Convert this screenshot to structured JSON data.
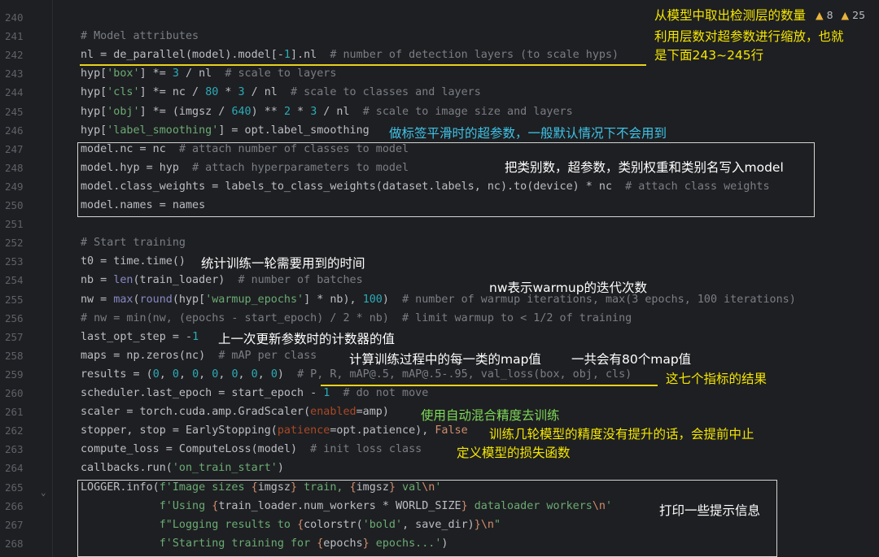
{
  "editor": {
    "inspections": {
      "weak_warnings": "8",
      "warnings": "25"
    },
    "lines": [
      {
        "num": "240",
        "tokens": []
      },
      {
        "num": "241",
        "tokens": [
          [
            "cm",
            "# Model attributes"
          ]
        ]
      },
      {
        "num": "242",
        "tokens": [
          [
            "",
            "nl = de_parallel(model).model[-"
          ],
          [
            "num",
            "1"
          ],
          [
            "",
            "].nl  "
          ],
          [
            "cm",
            "# number of detection layers (to scale hyps)"
          ]
        ]
      },
      {
        "num": "243",
        "tokens": [
          [
            "",
            "hyp["
          ],
          [
            "str",
            "'box'"
          ],
          [
            "",
            "] *= "
          ],
          [
            "num",
            "3"
          ],
          [
            "",
            " / nl  "
          ],
          [
            "cm",
            "# scale to layers"
          ]
        ]
      },
      {
        "num": "244",
        "tokens": [
          [
            "",
            "hyp["
          ],
          [
            "str",
            "'cls'"
          ],
          [
            "",
            "] *= nc / "
          ],
          [
            "num",
            "80"
          ],
          [
            "",
            " * "
          ],
          [
            "num",
            "3"
          ],
          [
            "",
            " / nl  "
          ],
          [
            "cm",
            "# scale to classes and layers"
          ]
        ]
      },
      {
        "num": "245",
        "tokens": [
          [
            "",
            "hyp["
          ],
          [
            "str",
            "'obj'"
          ],
          [
            "",
            "] *= (imgsz / "
          ],
          [
            "num",
            "640"
          ],
          [
            "",
            ") ** "
          ],
          [
            "num",
            "2"
          ],
          [
            "",
            " * "
          ],
          [
            "num",
            "3"
          ],
          [
            "",
            " / nl  "
          ],
          [
            "cm",
            "# scale to image size and layers"
          ]
        ]
      },
      {
        "num": "246",
        "tokens": [
          [
            "",
            "hyp["
          ],
          [
            "str",
            "'label_smoothing'"
          ],
          [
            "",
            "] = opt.label_smoothing"
          ]
        ]
      },
      {
        "num": "247",
        "tokens": [
          [
            "",
            "model.nc = nc  "
          ],
          [
            "cm",
            "# attach number of classes to model"
          ]
        ]
      },
      {
        "num": "248",
        "tokens": [
          [
            "",
            "model.hyp = hyp  "
          ],
          [
            "cm",
            "# attach hyperparameters to model"
          ]
        ]
      },
      {
        "num": "249",
        "tokens": [
          [
            "",
            "model.class_weights = labels_to_class_weights(dataset.labels, nc).to(device) * nc  "
          ],
          [
            "cm",
            "# attach class weights"
          ]
        ]
      },
      {
        "num": "250",
        "tokens": [
          [
            "",
            "model.names = names"
          ]
        ]
      },
      {
        "num": "251",
        "tokens": []
      },
      {
        "num": "252",
        "tokens": [
          [
            "cm",
            "# Start training"
          ]
        ]
      },
      {
        "num": "253",
        "tokens": [
          [
            "",
            "t0 = time.time()"
          ]
        ]
      },
      {
        "num": "254",
        "tokens": [
          [
            "",
            "nb = "
          ],
          [
            "bi",
            "len"
          ],
          [
            "",
            "(train_loader)  "
          ],
          [
            "cm",
            "# number of batches"
          ]
        ]
      },
      {
        "num": "255",
        "tokens": [
          [
            "",
            "nw = "
          ],
          [
            "bi",
            "max"
          ],
          [
            "",
            "("
          ],
          [
            "bi",
            "round"
          ],
          [
            "",
            "(hyp["
          ],
          [
            "str",
            "'warmup_epochs'"
          ],
          [
            "",
            "] * nb), "
          ],
          [
            "num",
            "100"
          ],
          [
            "",
            ")  "
          ],
          [
            "cm",
            "# number of warmup iterations, max(3 epochs, 100 iterations)"
          ]
        ]
      },
      {
        "num": "256",
        "tokens": [
          [
            "cm",
            "# nw = min(nw, (epochs - start_epoch) / 2 * nb)  # limit warmup to < 1/2 of training"
          ]
        ]
      },
      {
        "num": "257",
        "tokens": [
          [
            "",
            "last_opt_step = -"
          ],
          [
            "num",
            "1"
          ]
        ]
      },
      {
        "num": "258",
        "tokens": [
          [
            "",
            "maps = np.zeros(nc)  "
          ],
          [
            "cm",
            "# mAP per class"
          ]
        ]
      },
      {
        "num": "259",
        "tokens": [
          [
            "",
            "results = ("
          ],
          [
            "num",
            "0"
          ],
          [
            "",
            ", "
          ],
          [
            "num",
            "0"
          ],
          [
            "",
            ", "
          ],
          [
            "num",
            "0"
          ],
          [
            "",
            ", "
          ],
          [
            "num",
            "0"
          ],
          [
            "",
            ", "
          ],
          [
            "num",
            "0"
          ],
          [
            "",
            ", "
          ],
          [
            "num",
            "0"
          ],
          [
            "",
            ", "
          ],
          [
            "num",
            "0"
          ],
          [
            "",
            ")  "
          ],
          [
            "cm",
            "# P, R, mAP@.5, mAP@.5-.95, val_loss(box, obj, cls)"
          ]
        ]
      },
      {
        "num": "260",
        "tokens": [
          [
            "",
            "scheduler.last_epoch = start_epoch - "
          ],
          [
            "num",
            "1"
          ],
          [
            "",
            "  "
          ],
          [
            "cm",
            "# do not move"
          ]
        ]
      },
      {
        "num": "261",
        "tokens": [
          [
            "",
            "scaler = torch.cuda.amp.GradScaler("
          ],
          [
            "prm",
            "enabled"
          ],
          [
            "",
            "=amp)"
          ]
        ]
      },
      {
        "num": "262",
        "tokens": [
          [
            "",
            "stopper, stop = EarlyStopping("
          ],
          [
            "prm",
            "patience"
          ],
          [
            "",
            "=opt.patience), "
          ],
          [
            "kw",
            "False"
          ]
        ]
      },
      {
        "num": "263",
        "tokens": [
          [
            "",
            "compute_loss = ComputeLoss(model)  "
          ],
          [
            "cm",
            "# init loss class"
          ]
        ]
      },
      {
        "num": "264",
        "tokens": [
          [
            "",
            "callbacks.run("
          ],
          [
            "str",
            "'on_train_start'"
          ],
          [
            "",
            ")"
          ]
        ]
      },
      {
        "num": "265",
        "tokens": [
          [
            "",
            "LOGGER.info("
          ],
          [
            "str",
            "f'Image sizes "
          ],
          [
            "sc",
            "{"
          ],
          [
            "fv",
            "imgsz"
          ],
          [
            "sc",
            "}"
          ],
          [
            "str",
            " train, "
          ],
          [
            "sc",
            "{"
          ],
          [
            "fv",
            "imgsz"
          ],
          [
            "sc",
            "}"
          ],
          [
            "str",
            " val"
          ],
          [
            "esc",
            "\\n"
          ],
          [
            "str",
            "'"
          ]
        ]
      },
      {
        "num": "266",
        "tokens": [
          [
            "",
            "            "
          ],
          [
            "str",
            "f'Using "
          ],
          [
            "sc",
            "{"
          ],
          [
            "fv",
            "train_loader.num_workers * WORLD_SIZE"
          ],
          [
            "sc",
            "}"
          ],
          [
            "str",
            " dataloader workers"
          ],
          [
            "esc",
            "\\n"
          ],
          [
            "str",
            "'"
          ]
        ]
      },
      {
        "num": "267",
        "tokens": [
          [
            "",
            "            "
          ],
          [
            "str",
            "f\"Logging results to "
          ],
          [
            "sc",
            "{"
          ],
          [
            "fv",
            "colorstr("
          ],
          [
            "str",
            "'bold'"
          ],
          [
            "fv",
            ", save_dir)"
          ],
          [
            "sc",
            "}"
          ],
          [
            "esc",
            "\\n"
          ],
          [
            "str",
            "\""
          ]
        ]
      },
      {
        "num": "268",
        "tokens": [
          [
            "",
            "            "
          ],
          [
            "str",
            "f'Starting training for "
          ],
          [
            "sc",
            "{"
          ],
          [
            "fv",
            "epochs"
          ],
          [
            "sc",
            "}"
          ],
          [
            "str",
            " epochs...'"
          ],
          [
            "",
            ")"
          ]
        ]
      }
    ]
  },
  "annotations": {
    "detect_layers": "从模型中取出检测层的数量",
    "scale_hyps": "利用层数对超参数进行缩放，也就",
    "lines_ref": "是下面243~245行",
    "label_smoothing": "做标签平滑时的超参数，一般默认情况下不会用到",
    "write_model": "把类别数，超参数，类别权重和类别名写入model",
    "epoch_time": "统计训练一轮需要用到的时间",
    "nw_desc": "nw表示warmup的迭代次数",
    "last_step": "上一次更新参数时的计数器的值",
    "map_per_class": "计算训练过程中的每一类的map值",
    "map_count": "一共会有80个map值",
    "seven_metrics": "这七个指标的结果",
    "amp": "使用自动混合精度去训练",
    "early_stop": "训练几轮模型的精度没有提升的话，会提前中止",
    "loss_fn": "定义模型的损失函数",
    "print_info": "打印一些提示信息"
  },
  "colors": {
    "background": "#1e1f22",
    "annotation_yellow": "#f4e600",
    "annotation_cyan": "#3ec4e8",
    "annotation_green": "#7ed957",
    "annotation_white": "#ffffff"
  }
}
